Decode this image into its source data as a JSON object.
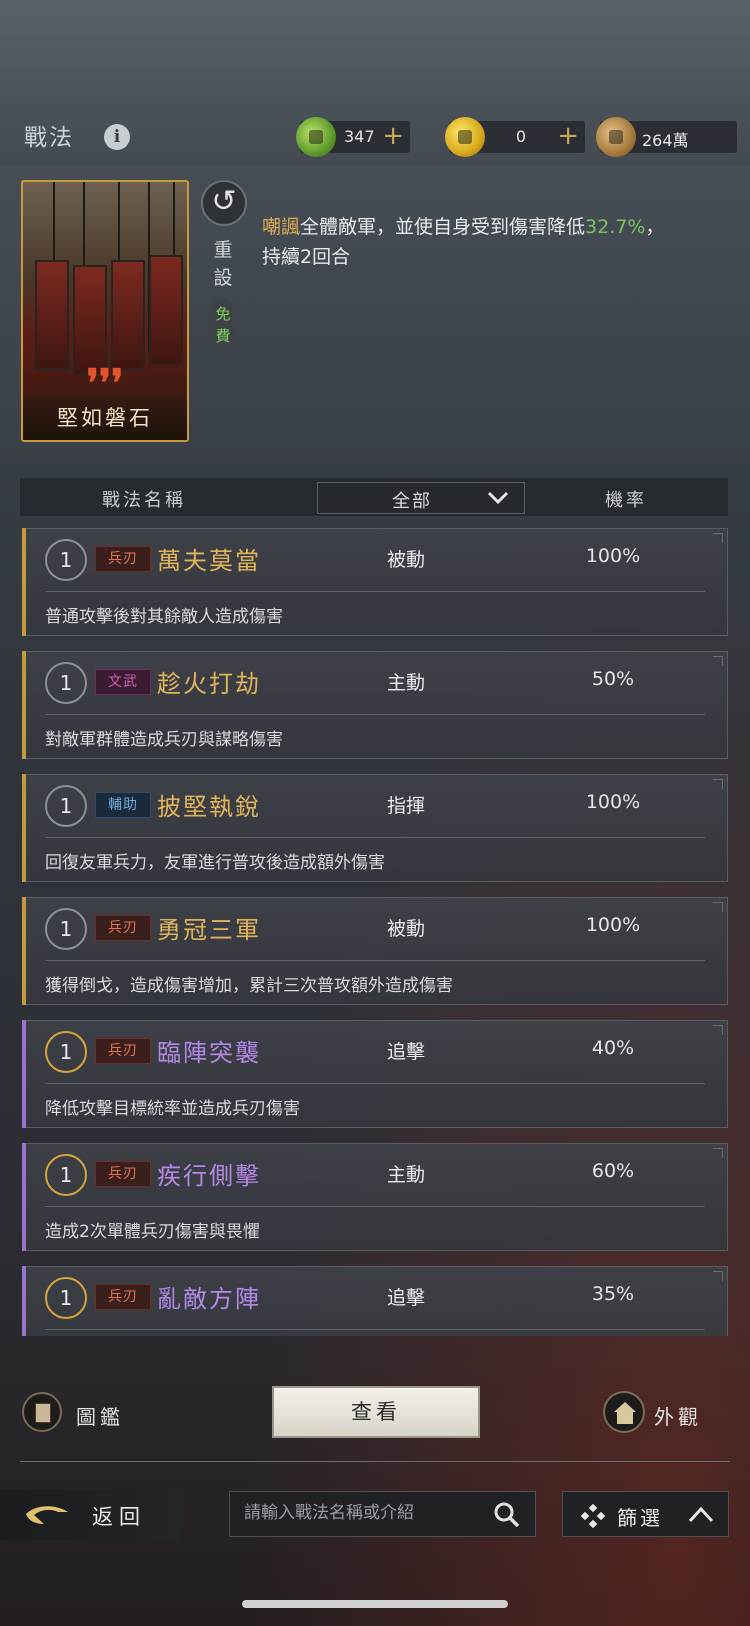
{
  "header": {
    "title": "戰法",
    "info_icon": "i",
    "resources": [
      {
        "icon": "jade-coin-icon",
        "value": "347",
        "plus": "+"
      },
      {
        "icon": "gold-coin-icon",
        "value": "0",
        "plus": "+"
      },
      {
        "icon": "bronze-coin-icon",
        "value": "264萬"
      }
    ]
  },
  "skill": {
    "card_name": "堅如磐石",
    "card_quotes": "❜❜❜",
    "reset_icon": "↺",
    "reset_label": "重設",
    "free_label": "免費",
    "desc_keyword": "嘲諷",
    "desc_part1": "全體敵軍，並使自身受到傷害降低",
    "desc_value": "32.7%",
    "desc_part2": "，持續2回合"
  },
  "table_header": {
    "name": "戰法名稱",
    "filter": "全部",
    "rate": "機率"
  },
  "items": [
    {
      "level": "1",
      "type": "兵刃",
      "type_class": "t-bing",
      "name": "萬夫莫當",
      "kind": "被動",
      "rate": "100%",
      "desc": "普通攻擊後對其餘敵人造成傷害",
      "quality": "gold"
    },
    {
      "level": "1",
      "type": "文武",
      "type_class": "t-wenwu",
      "name": "趁火打劫",
      "kind": "主動",
      "rate": "50%",
      "desc": "對敵軍群體造成兵刃與謀略傷害",
      "quality": "gold"
    },
    {
      "level": "1",
      "type": "輔助",
      "type_class": "t-fuzhu",
      "name": "披堅執銳",
      "kind": "指揮",
      "rate": "100%",
      "desc": "回復友軍兵力，友軍進行普攻後造成額外傷害",
      "quality": "gold"
    },
    {
      "level": "1",
      "type": "兵刃",
      "type_class": "t-bing",
      "name": "勇冠三軍",
      "kind": "被動",
      "rate": "100%",
      "desc": "獲得倒戈，造成傷害增加，累計三次普攻額外造成傷害",
      "quality": "gold"
    },
    {
      "level": "1",
      "type": "兵刃",
      "type_class": "t-bing",
      "name": "臨陣突襲",
      "kind": "追擊",
      "rate": "40%",
      "desc": "降低攻擊目標統率並造成兵刃傷害",
      "quality": "purple"
    },
    {
      "level": "1",
      "type": "兵刃",
      "type_class": "t-bing",
      "name": "疾行側擊",
      "kind": "主動",
      "rate": "60%",
      "desc": "造成2次單體兵刃傷害與畏懼",
      "quality": "purple"
    },
    {
      "level": "1",
      "type": "兵刃",
      "type_class": "t-bing",
      "name": "亂敵方陣",
      "kind": "追擊",
      "rate": "35%",
      "desc": "",
      "quality": "purple"
    }
  ],
  "bottom": {
    "tujian_label": "圖鑑",
    "view_label": "查看",
    "waiguan_label": "外觀",
    "back_label": "返回",
    "search_placeholder": "請輸入戰法名稱或介紹",
    "filter_label": "篩選"
  }
}
